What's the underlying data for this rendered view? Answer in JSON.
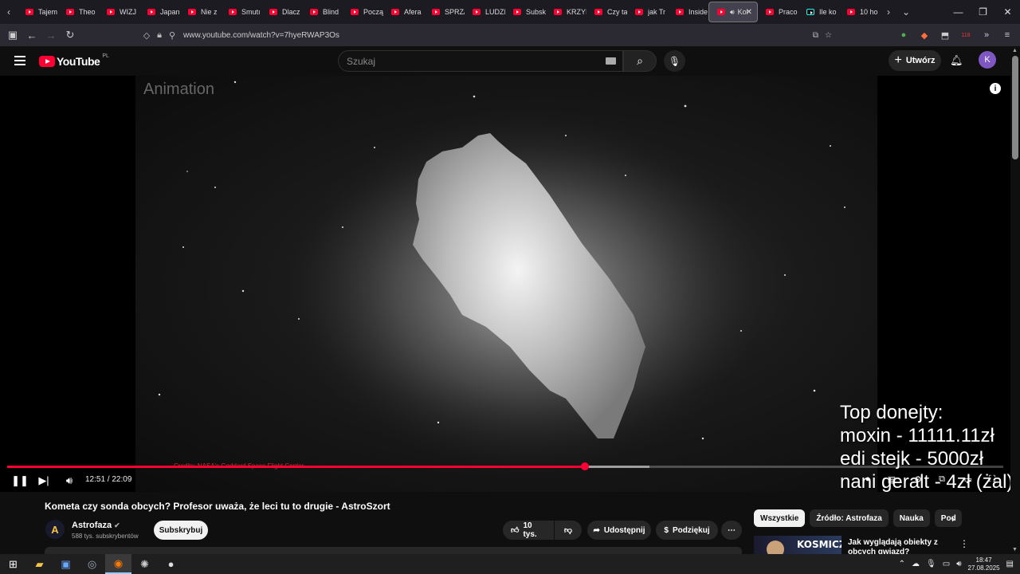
{
  "browser": {
    "tabs": [
      {
        "label": "Tajem",
        "icon": "youtube-icon"
      },
      {
        "label": "Theo",
        "icon": "youtube-icon"
      },
      {
        "label": "WIZJ",
        "icon": "youtube-icon"
      },
      {
        "label": "Japan",
        "icon": "youtube-icon"
      },
      {
        "label": "Nie z",
        "icon": "youtube-icon"
      },
      {
        "label": "Smutı",
        "icon": "youtube-icon"
      },
      {
        "label": "Dlacz",
        "icon": "youtube-icon"
      },
      {
        "label": "Blind",
        "icon": "youtube-icon"
      },
      {
        "label": "Począ",
        "icon": "youtube-icon"
      },
      {
        "label": "Afera",
        "icon": "youtube-icon"
      },
      {
        "label": "SPRZ/",
        "icon": "youtube-icon"
      },
      {
        "label": "LUDZI",
        "icon": "youtube-icon"
      },
      {
        "label": "Subsk",
        "icon": "youtube-icon"
      },
      {
        "label": "KRZYI",
        "icon": "youtube-icon"
      },
      {
        "label": "Czy ta",
        "icon": "youtube-icon"
      },
      {
        "label": "jak Tr",
        "icon": "youtube-icon"
      },
      {
        "label": "Inside",
        "icon": "youtube-icon"
      },
      {
        "label": "Kol",
        "icon": "youtube-icon",
        "active": true
      },
      {
        "label": "Praco",
        "icon": "youtube-icon"
      },
      {
        "label": "Ile ko",
        "icon": "tiktok-icon"
      },
      {
        "label": "10 ho",
        "icon": "youtube-icon"
      }
    ],
    "url": "www.youtube.com/watch?v=7hyeRWAP3Os",
    "ext_badge": "118"
  },
  "youtube": {
    "logo_text": "YouTube",
    "country_code": "PL",
    "search_placeholder": "Szukaj",
    "create_label": "Utwórz",
    "avatar_letter": "K"
  },
  "player": {
    "overlay_label": "Animation",
    "credits": "Credits: NASA's Goddard Space Flight Center",
    "current_time": "12:51",
    "duration": "22:09",
    "time_display": "12:51 / 22:09",
    "progress_fraction": 0.58,
    "buffered_fraction": 0.645,
    "donations": [
      "Top donejty:",
      "moxin - 11111.11zł",
      "edi stejk - 5000zł",
      "nani geralt - 4zł (żal)"
    ]
  },
  "video": {
    "title": "Kometa czy sonda obcych? Profesor uważa, że leci tu to drugie - AstroSzort",
    "channel": "Astrofaza",
    "subscribers": "588 tys. subskrybentów",
    "subscribe_label": "Subskrybuj",
    "likes": "10 tys.",
    "share_label": "Udostępnij",
    "thanks_label": "Podziękuj"
  },
  "sidebar": {
    "chips": [
      "Wszystkie",
      "Źródło: Astrofaza",
      "Nauka",
      "Pod"
    ],
    "recommended": {
      "thumb_text": "KOSMICZNI",
      "title": "Jak wyglądają obiekty z obcych gwiazd?"
    }
  },
  "taskbar": {
    "time": "18:47",
    "date": "27.08.2025"
  },
  "colors": {
    "accent_red": "#ff0033",
    "bg": "#0f0f0f"
  }
}
